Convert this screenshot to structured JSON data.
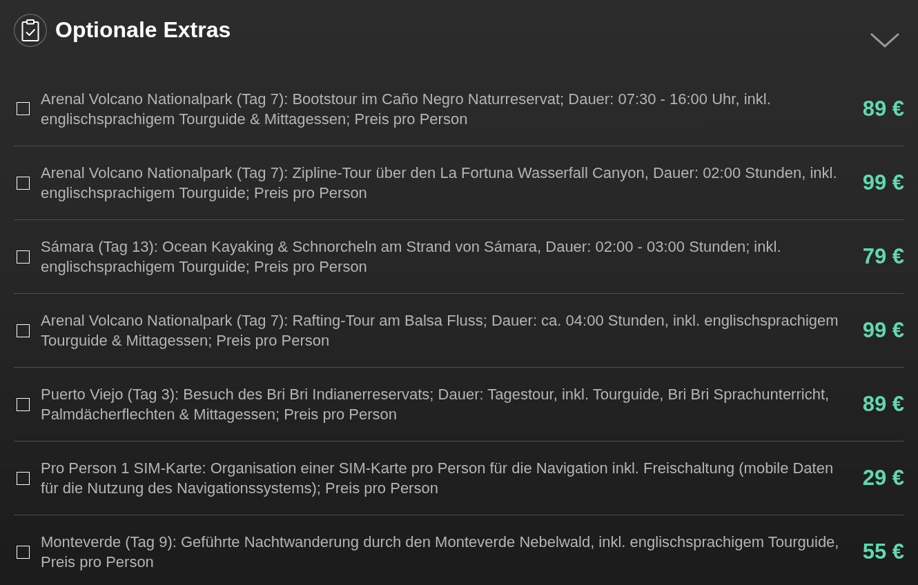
{
  "section": {
    "title": "Optionale Extras",
    "expanded": true
  },
  "extras": [
    {
      "label": "Arenal Volcano Nationalpark (Tag 7): Bootstour im Caño Negro Naturreservat; Dauer: 07:30 - 16:00 Uhr, inkl. englischsprachigem Tourguide & Mittagessen; Preis pro Person",
      "price": "89 €",
      "checked": false
    },
    {
      "label": "Arenal Volcano Nationalpark (Tag 7): Zipline-Tour über den La Fortuna Wasserfall Canyon, Dauer: 02:00 Stunden, inkl. englischsprachigem Tourguide; Preis pro Person",
      "price": "99 €",
      "checked": false
    },
    {
      "label": "Sámara (Tag 13): Ocean Kayaking & Schnorcheln am Strand von Sámara, Dauer: 02:00 - 03:00 Stunden; inkl. englischsprachigem Tourguide; Preis pro Person",
      "price": "79 €",
      "checked": false
    },
    {
      "label": "Arenal Volcano Nationalpark (Tag 7): Rafting-Tour am Balsa Fluss; Dauer: ca. 04:00 Stunden, inkl. englischsprachigem Tourguide & Mittagessen; Preis pro Person",
      "price": "99 €",
      "checked": false
    },
    {
      "label": "Puerto Viejo (Tag 3): Besuch des Bri Bri Indianerreservats; Dauer: Tagestour, inkl. Tourguide, Bri Bri Sprachunterricht, Palmdächerflechten & Mittagessen; Preis pro Person",
      "price": "89 €",
      "checked": false
    },
    {
      "label": "Pro Person 1 SIM-Karte: Organisation einer SIM-Karte pro Person für die Navigation inkl. Freischaltung (mobile Daten für die Nutzung des Navigationssystems); Preis pro Person",
      "price": "29 €",
      "checked": false
    },
    {
      "label": "Monteverde (Tag 9): Geführte Nachtwanderung durch den Monteverde Nebelwald, inkl. englischsprachigem Tourguide, Preis pro Person",
      "price": "55 €",
      "checked": false
    }
  ]
}
